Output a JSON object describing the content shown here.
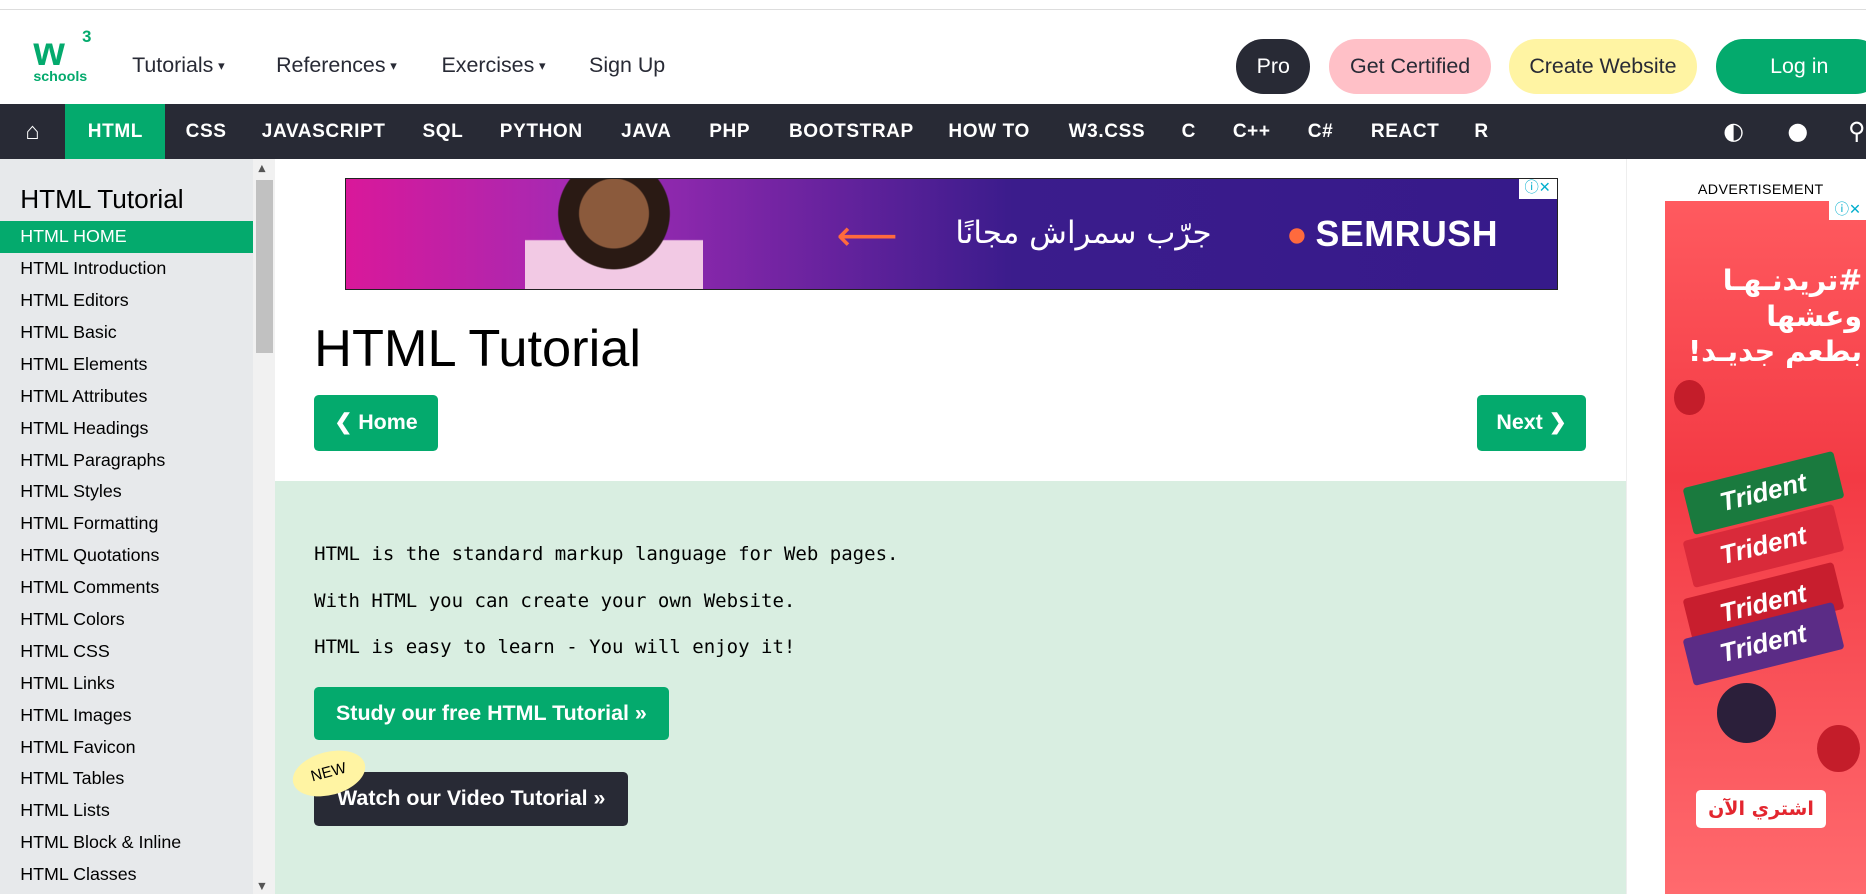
{
  "header": {
    "logo_mark": "w",
    "logo_sup": "3",
    "logo_text": "schools",
    "menus": [
      {
        "label": "Tutorials",
        "caret": "▾"
      },
      {
        "label": "References",
        "caret": "▾"
      },
      {
        "label": "Exercises",
        "caret": "▾"
      }
    ],
    "sign_up": "Sign Up",
    "pro": "Pro",
    "get_certified": "Get Certified",
    "create_website": "Create Website",
    "log_in": "Log in"
  },
  "topnav": {
    "home_icon": "⌂",
    "items": [
      "HTML",
      "CSS",
      "JAVASCRIPT",
      "SQL",
      "PYTHON",
      "JAVA",
      "PHP",
      "BOOTSTRAP",
      "HOW TO",
      "W3.CSS",
      "C",
      "C++",
      "C#",
      "REACT",
      "R"
    ],
    "icons": {
      "contrast": "◐",
      "globe": "●",
      "search": "⚲"
    }
  },
  "sidebar": {
    "heading": "HTML Tutorial",
    "items": [
      "HTML HOME",
      "HTML Introduction",
      "HTML Editors",
      "HTML Basic",
      "HTML Elements",
      "HTML Attributes",
      "HTML Headings",
      "HTML Paragraphs",
      "HTML Styles",
      "HTML Formatting",
      "HTML Quotations",
      "HTML Comments",
      "HTML Colors",
      "HTML CSS",
      "HTML Links",
      "HTML Images",
      "HTML Favicon",
      "HTML Tables",
      "HTML Lists",
      "HTML Block & Inline",
      "HTML Classes"
    ]
  },
  "ad_top": {
    "arabic": "جرّب سمراش مجانًا",
    "brand": "SEMRUSH",
    "arrow": "⟵"
  },
  "main": {
    "title": "HTML Tutorial",
    "home_btn": "❮ Home",
    "next_btn": "Next ❯",
    "paragraphs": [
      "HTML is the standard markup language for Web pages.",
      "With HTML you can create your own Website.",
      "HTML is easy to learn - You will enjoy it!"
    ],
    "study_btn": "Study our free HTML Tutorial »",
    "video_btn": "Watch our Video Tutorial »",
    "new_badge": "NEW"
  },
  "right_ad": {
    "label": "ADVERTISEMENT",
    "headline": "#تريدنـهـا وعشها بطعم جديـد!",
    "pack_text": "Trident",
    "buy": "اشتري الآن"
  },
  "colors": {
    "accent": "#04AA6D",
    "dark": "#282A35",
    "sidebar": "#E7E9EB",
    "green_box": "#D9EEE1",
    "pink": "#FFC0C7",
    "yellow": "#FFF4A3"
  }
}
